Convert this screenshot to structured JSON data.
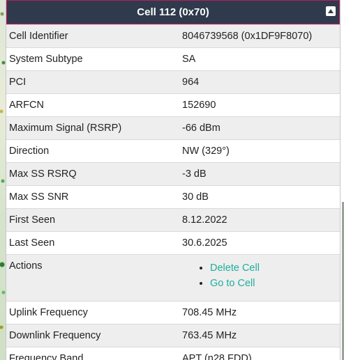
{
  "header": {
    "title": "Cell 112 (0x70)"
  },
  "rows": [
    {
      "label": "Cell Identifier",
      "value": "8046739568 (0x1DF9F8070)"
    },
    {
      "label": "System Subtype",
      "value": "SA"
    },
    {
      "label": "PCI",
      "value": "964"
    },
    {
      "label": "ARFCN",
      "value": "152690"
    },
    {
      "label": "Maximum Signal (RSRP)",
      "value": "-66 dBm"
    },
    {
      "label": "Direction",
      "value": "NW (329°)"
    },
    {
      "label": "Max SS RSRQ",
      "value": "-3 dB"
    },
    {
      "label": "Max SS SNR",
      "value": "30 dB"
    },
    {
      "label": "First Seen",
      "value": "8.12.2022"
    },
    {
      "label": "Last Seen",
      "value": "30.6.2025"
    }
  ],
  "actions": {
    "label": "Actions",
    "items": [
      "Delete Cell",
      "Go to Cell"
    ]
  },
  "rows2": [
    {
      "label": "Uplink Frequency",
      "value": "708.45 MHz"
    },
    {
      "label": "Downlink Frequency",
      "value": "763.45 MHz"
    },
    {
      "label": "Frequency Band",
      "value": "APT (n28 FDD)"
    }
  ],
  "colors": {
    "header_bg": "#2f3b4c",
    "header_border": "#c2185b",
    "link": "#1fae9c",
    "alt_row": "#eeeeee"
  },
  "icons": {
    "collapse": "caret-up-icon"
  }
}
